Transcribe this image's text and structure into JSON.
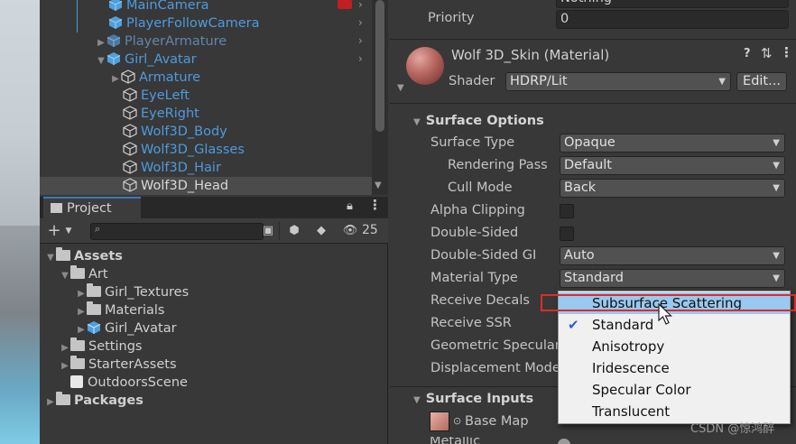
{
  "hierarchy": {
    "items": [
      {
        "label": "MainCamera",
        "icon": "gameobject-cube-icon"
      },
      {
        "label": "PlayerFollowCamera",
        "icon": "gameobject-cube-icon"
      },
      {
        "label": "PlayerArmature",
        "icon": "prefab-cube-icon"
      },
      {
        "label": "Girl_Avatar",
        "icon": "prefab-cube-icon"
      },
      {
        "label": "Armature",
        "icon": "gameobject-cube-icon"
      },
      {
        "label": "EyeLeft",
        "icon": "gameobject-cube-icon"
      },
      {
        "label": "EyeRight",
        "icon": "gameobject-cube-icon"
      },
      {
        "label": "Wolf3D_Body",
        "icon": "gameobject-cube-icon"
      },
      {
        "label": "Wolf3D_Glasses",
        "icon": "gameobject-cube-icon"
      },
      {
        "label": "Wolf3D_Hair",
        "icon": "gameobject-cube-icon"
      },
      {
        "label": "Wolf3D_Head",
        "icon": "gameobject-cube-icon"
      }
    ],
    "selected": "Wolf3D_Head"
  },
  "project": {
    "tab_label": "Project",
    "hidden_count": "25",
    "tree": [
      {
        "label": "Assets",
        "bold": true
      },
      {
        "label": "Art"
      },
      {
        "label": "Girl_Textures"
      },
      {
        "label": "Materials"
      },
      {
        "label": "Girl_Avatar"
      },
      {
        "label": "Settings"
      },
      {
        "label": "StarterAssets"
      },
      {
        "label": "OutdoorsScene"
      },
      {
        "label": "Packages",
        "bold": true
      }
    ]
  },
  "inspector": {
    "rendering_layer_value": "Nothing",
    "priority_label": "Priority",
    "priority_value": "0",
    "material_title": "Wolf 3D_Skin (Material)",
    "shader_label": "Shader",
    "shader_value": "HDRP/Lit",
    "edit_button": "Edit...",
    "surface_options_header": "Surface Options",
    "fields": {
      "surface_type": {
        "label": "Surface Type",
        "value": "Opaque"
      },
      "rendering_pass": {
        "label": "Rendering Pass",
        "value": "Default"
      },
      "cull_mode": {
        "label": "Cull Mode",
        "value": "Back"
      },
      "alpha_clipping": {
        "label": "Alpha Clipping"
      },
      "double_sided": {
        "label": "Double-Sided"
      },
      "double_sided_gi": {
        "label": "Double-Sided GI",
        "value": "Auto"
      },
      "material_type": {
        "label": "Material Type",
        "value": "Standard"
      },
      "receive_decals": {
        "label": "Receive Decals"
      },
      "receive_ssr": {
        "label": "Receive SSR"
      },
      "geometric_specular": {
        "label": "Geometric Specular"
      },
      "displacement_mode": {
        "label": "Displacement Mode"
      }
    },
    "surface_inputs_header": "Surface Inputs",
    "base_map_label": "Base Map",
    "metallic_label": "Metallic"
  },
  "material_type_dropdown": {
    "options": [
      "Subsurface Scattering",
      "Standard",
      "Anisotropy",
      "Iridescence",
      "Specular Color",
      "Translucent"
    ],
    "checked": "Standard",
    "highlighted": "Subsurface Scattering"
  },
  "watermark": "CSDN @惊鸿醉",
  "colors": {
    "hierarchy_text": "#4d9be0",
    "highlight": "#99c9ef",
    "annotation_red": "#e02a2a",
    "tab_accent": "#3a79bb"
  }
}
